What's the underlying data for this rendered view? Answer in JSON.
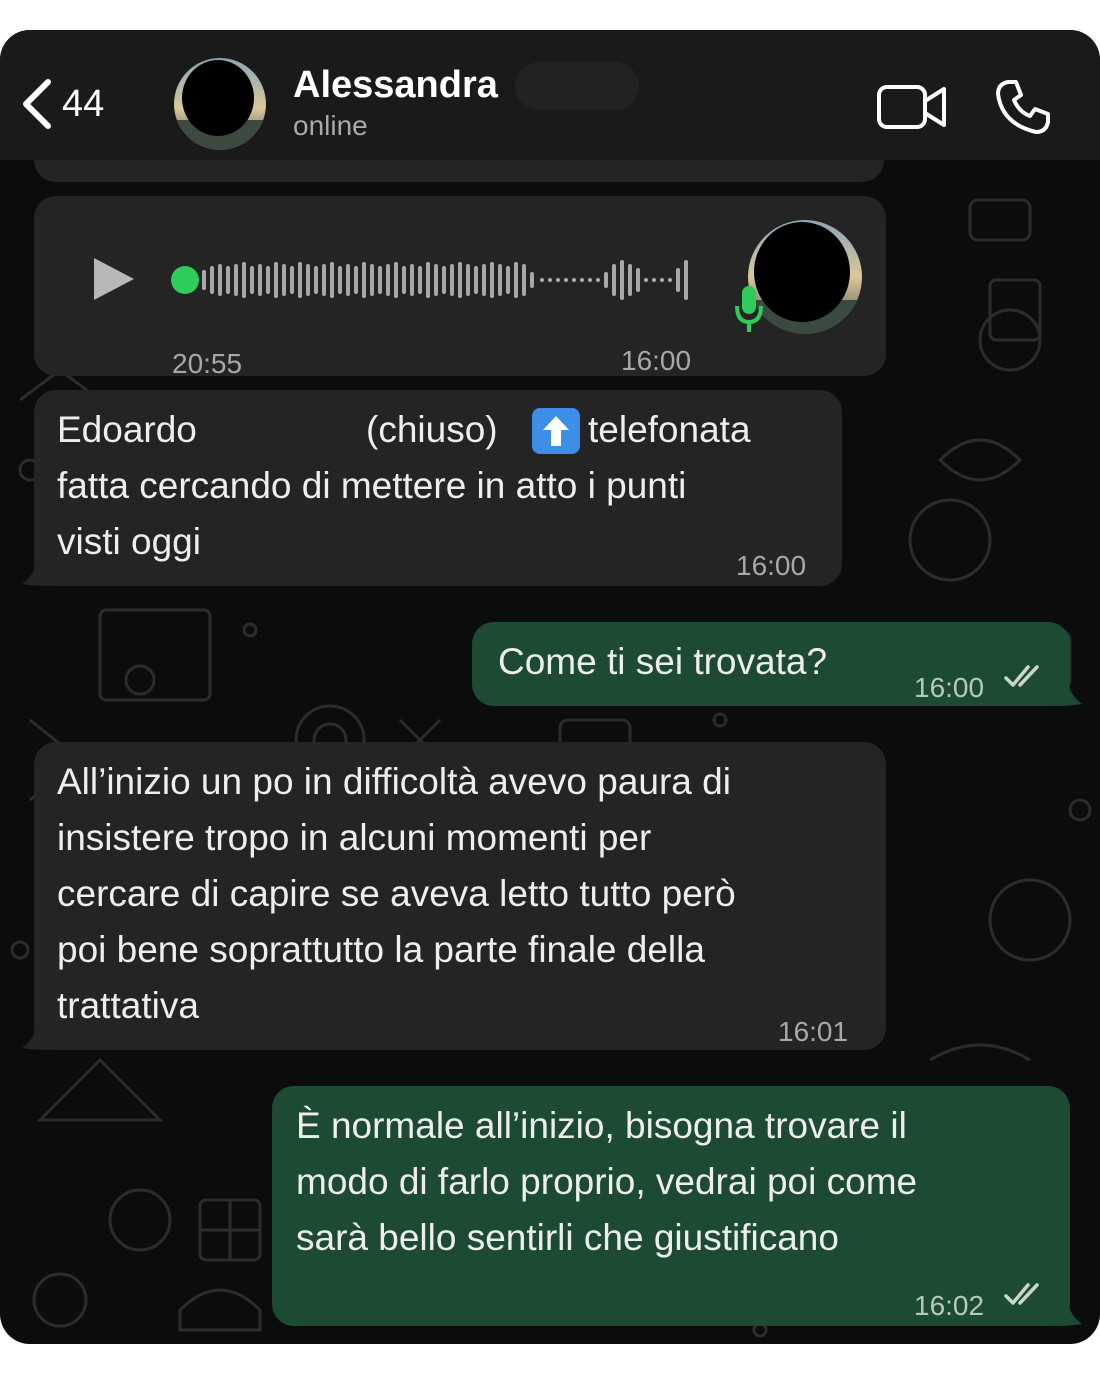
{
  "header": {
    "back_count": "44",
    "contact_name": "Alessandra",
    "status": "online"
  },
  "voice_message": {
    "duration": "20:55",
    "time": "16:00"
  },
  "messages": [
    {
      "direction": "incoming",
      "lines": [
        "Edoardo",
        "(chiuso)",
        "telefonata",
        "fatta cercando di mettere in atto i punti",
        "visti oggi"
      ],
      "emoji": "⬆️",
      "time": "16:00"
    },
    {
      "direction": "outgoing",
      "lines": [
        "Come ti sei trovata?"
      ],
      "time": "16:00",
      "status": "read"
    },
    {
      "direction": "incoming",
      "lines": [
        "All’inizio un po in difficoltà avevo paura di",
        "insistere tropo in alcuni momenti per",
        "cercare di capire se aveva letto tutto però",
        "poi bene soprattutto la parte finale della",
        "trattativa"
      ],
      "time": "16:01"
    },
    {
      "direction": "outgoing",
      "lines": [
        "È normale all’inizio, bisogna trovare il",
        "modo di farlo proprio, vedrai poi come",
        "sarà bello sentirli che giustificano"
      ],
      "time": "16:02",
      "status": "read"
    }
  ],
  "colors": {
    "background": "#0b0d0c",
    "header": "#1a1a1a",
    "incoming_bubble": "#242424",
    "outgoing_bubble": "#1d4a33",
    "accent_green": "#2ecc5a"
  },
  "icons": [
    "chevron-left-icon",
    "video-camera-icon",
    "phone-icon",
    "play-icon",
    "microphone-icon",
    "double-check-icon"
  ]
}
